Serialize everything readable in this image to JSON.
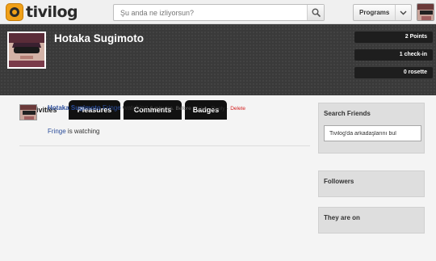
{
  "app": {
    "logo_text": "tivilog"
  },
  "search": {
    "placeholder": "Şu anda ne izliyorsun?"
  },
  "programs": {
    "label": "Programs"
  },
  "profile": {
    "name": "Hotaka Sugimoto",
    "stats": [
      "2 Points",
      "1 check-in",
      "0 rosette"
    ]
  },
  "tabs": [
    "Activities",
    "Pleasures",
    "Comments",
    "Badges"
  ],
  "active_tab": "Activities",
  "feed": {
    "user": "Hotaka Sugimoto",
    "show": "Fringe",
    "verb": "watching",
    "time": "6 minutes. Before",
    "like": "Like",
    "reply": "Reply",
    "delete": "Delete",
    "body_show": "Fringe",
    "body_text": "is watching"
  },
  "sidebar": {
    "search_friends_title": "Search Friends",
    "search_friends_value": "Tivilog'da arkadaşlarını bul",
    "followers_title": "Followers",
    "they_are_on_title": "They are on"
  },
  "colors": {
    "accent": "#f0a018",
    "link": "#2a4c9a",
    "delete": "#d42020",
    "header_bg": "#3a3a3a"
  }
}
